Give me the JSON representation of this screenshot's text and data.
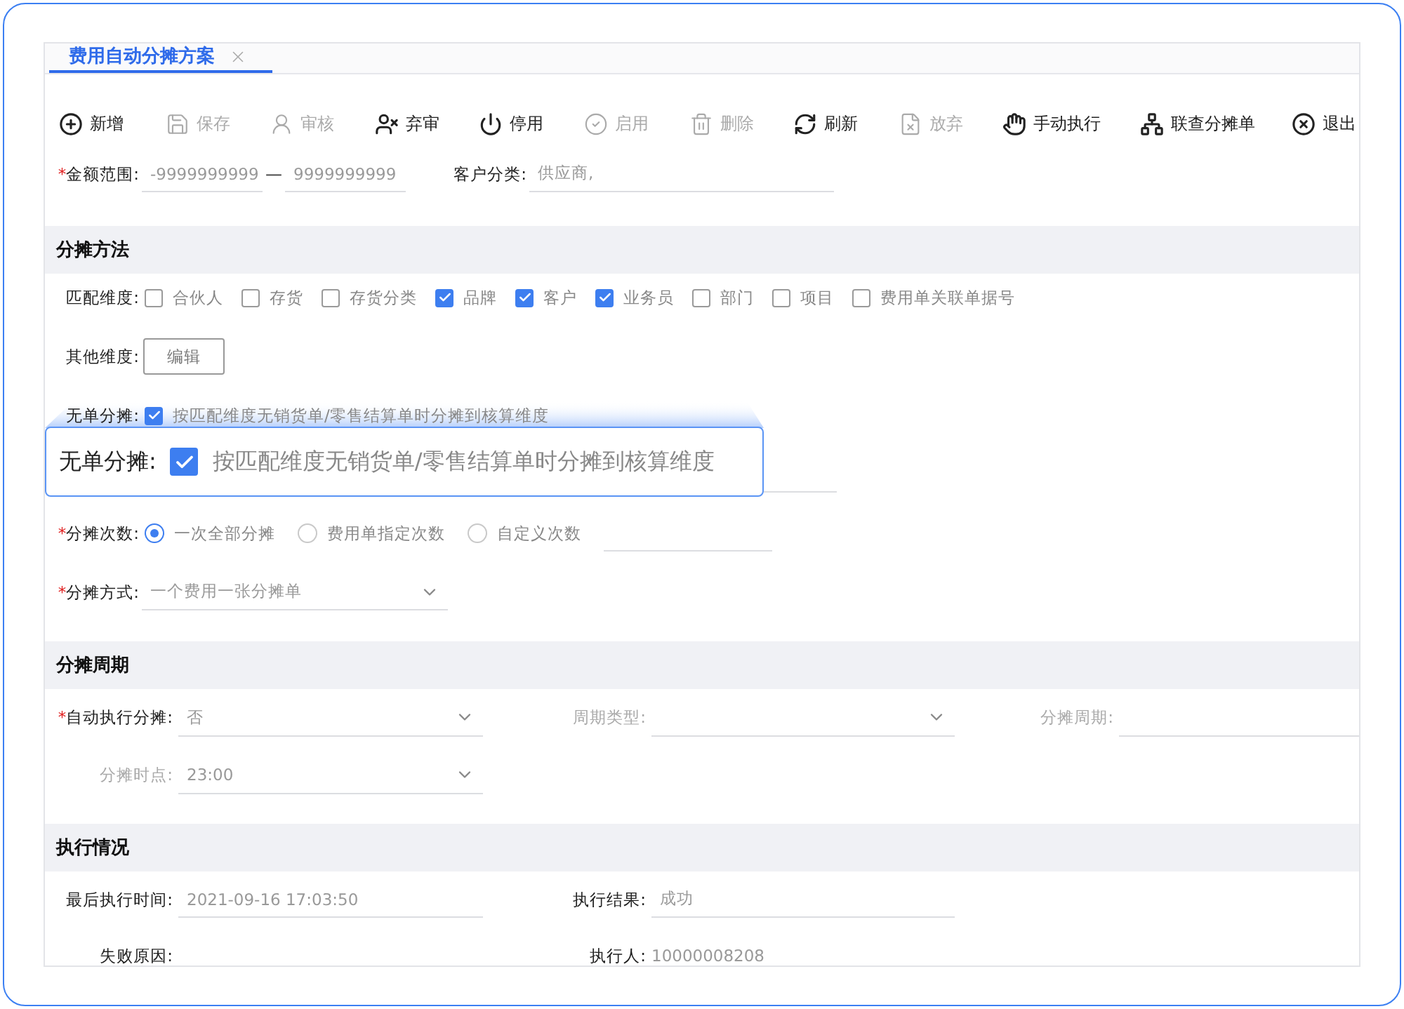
{
  "tab": {
    "label": "费用自动分摊方案",
    "selected": true
  },
  "toolbar": [
    {
      "label": "新增",
      "disabled": false
    },
    {
      "label": "保存",
      "disabled": true
    },
    {
      "label": "审核",
      "disabled": true
    },
    {
      "label": "弃审",
      "disabled": false
    },
    {
      "label": "停用",
      "disabled": false
    },
    {
      "label": "启用",
      "disabled": true
    },
    {
      "label": "删除",
      "disabled": true
    },
    {
      "label": "刷新",
      "disabled": false
    },
    {
      "label": "放弃",
      "disabled": true
    },
    {
      "label": "手动执行",
      "disabled": false
    },
    {
      "label": "联查分摊单",
      "disabled": false
    },
    {
      "label": "退出",
      "disabled": false
    }
  ],
  "amount": {
    "label": "金额范围:",
    "required_mark": "*",
    "min": "-9999999999",
    "separator": "—",
    "max": "9999999999",
    "customer_label": "客户分类:",
    "customer_value": "供应商,"
  },
  "method": {
    "title": "分摊方法",
    "match": {
      "label": "匹配维度:",
      "options": [
        {
          "label": "合伙人",
          "checked": false
        },
        {
          "label": "存货",
          "checked": false
        },
        {
          "label": "存货分类",
          "checked": false
        },
        {
          "label": "品牌",
          "checked": true
        },
        {
          "label": "客户",
          "checked": true
        },
        {
          "label": "业务员",
          "checked": true
        },
        {
          "label": "部门",
          "checked": false
        },
        {
          "label": "项目",
          "checked": false
        },
        {
          "label": "费用单关联单据号",
          "checked": false
        }
      ]
    },
    "other": {
      "label": "其他维度:",
      "button": "编辑"
    },
    "no_doc": {
      "label": "无单分摊:",
      "checked": true,
      "text": "按匹配维度无销货单/零售结算单时分摊到核算维度"
    },
    "callout": {
      "label": "无单分摊:",
      "checked": true,
      "text": "按匹配维度无销货单/零售结算单时分摊到核算维度"
    },
    "count": {
      "label": "分摊次数:",
      "required_mark": "*",
      "options": [
        {
          "label": "一次全部分摊",
          "selected": true
        },
        {
          "label": "费用单指定次数",
          "selected": false
        },
        {
          "label": "自定义次数",
          "selected": false
        }
      ]
    },
    "mode": {
      "label": "分摊方式:",
      "required_mark": "*",
      "value": "一个费用一张分摊单"
    }
  },
  "period": {
    "title": "分摊周期",
    "fields": [
      {
        "kind": "select",
        "label": "自动执行分摊:",
        "value": "否",
        "required_mark": "*",
        "disabled": false
      },
      {
        "kind": "select",
        "label": "周期类型:",
        "disabled": true
      },
      {
        "kind": "input",
        "label": "分摊周期:",
        "disabled": true
      },
      {
        "kind": "select",
        "label": "分摊时点:",
        "value": "23:00",
        "disabled": true
      }
    ]
  },
  "execution": {
    "title": "执行情况",
    "fields": [
      {
        "kind": "input",
        "label": "最后执行时间:",
        "value": "2021-09-16 17:03:50"
      },
      {
        "kind": "input",
        "label": "执行结果:",
        "value": "成功"
      },
      {
        "kind": "text",
        "label": "失败原因:"
      },
      {
        "kind": "text",
        "label": "执行人:",
        "value": "10000008208"
      }
    ]
  }
}
